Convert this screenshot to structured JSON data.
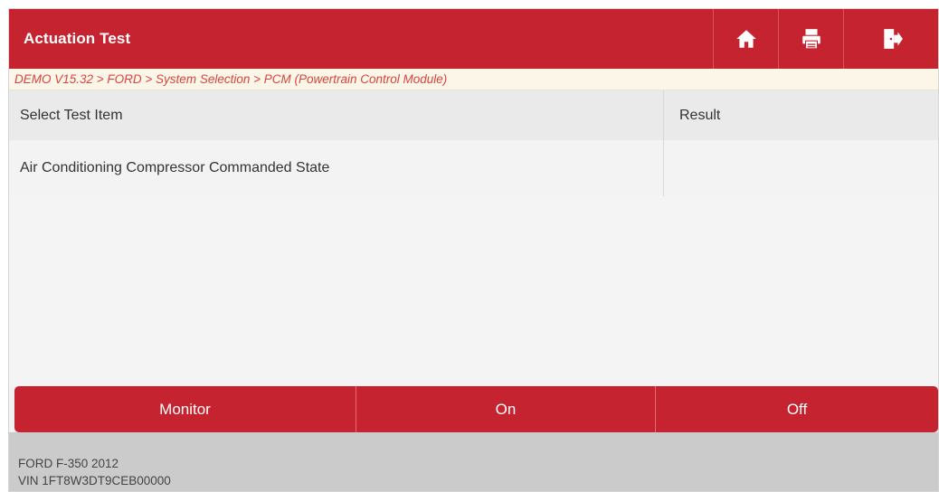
{
  "header": {
    "title": "Actuation Test",
    "accent_color": "#c4232f",
    "toolbar": [
      {
        "name": "home-icon"
      },
      {
        "name": "print-icon"
      },
      {
        "name": "exit-icon"
      }
    ]
  },
  "breadcrumb": "DEMO V15.32 > FORD > System Selection > PCM (Powertrain Control Module)",
  "table": {
    "columns": [
      "Select Test Item",
      "Result"
    ],
    "rows": [
      {
        "item": "Air Conditioning Compressor Commanded State",
        "result": ""
      }
    ]
  },
  "actions": [
    "Monitor",
    "On",
    "Off"
  ],
  "vehicle": {
    "model": "FORD F-350 2012",
    "vin": "VIN 1FT8W3DT9CEB00000"
  }
}
